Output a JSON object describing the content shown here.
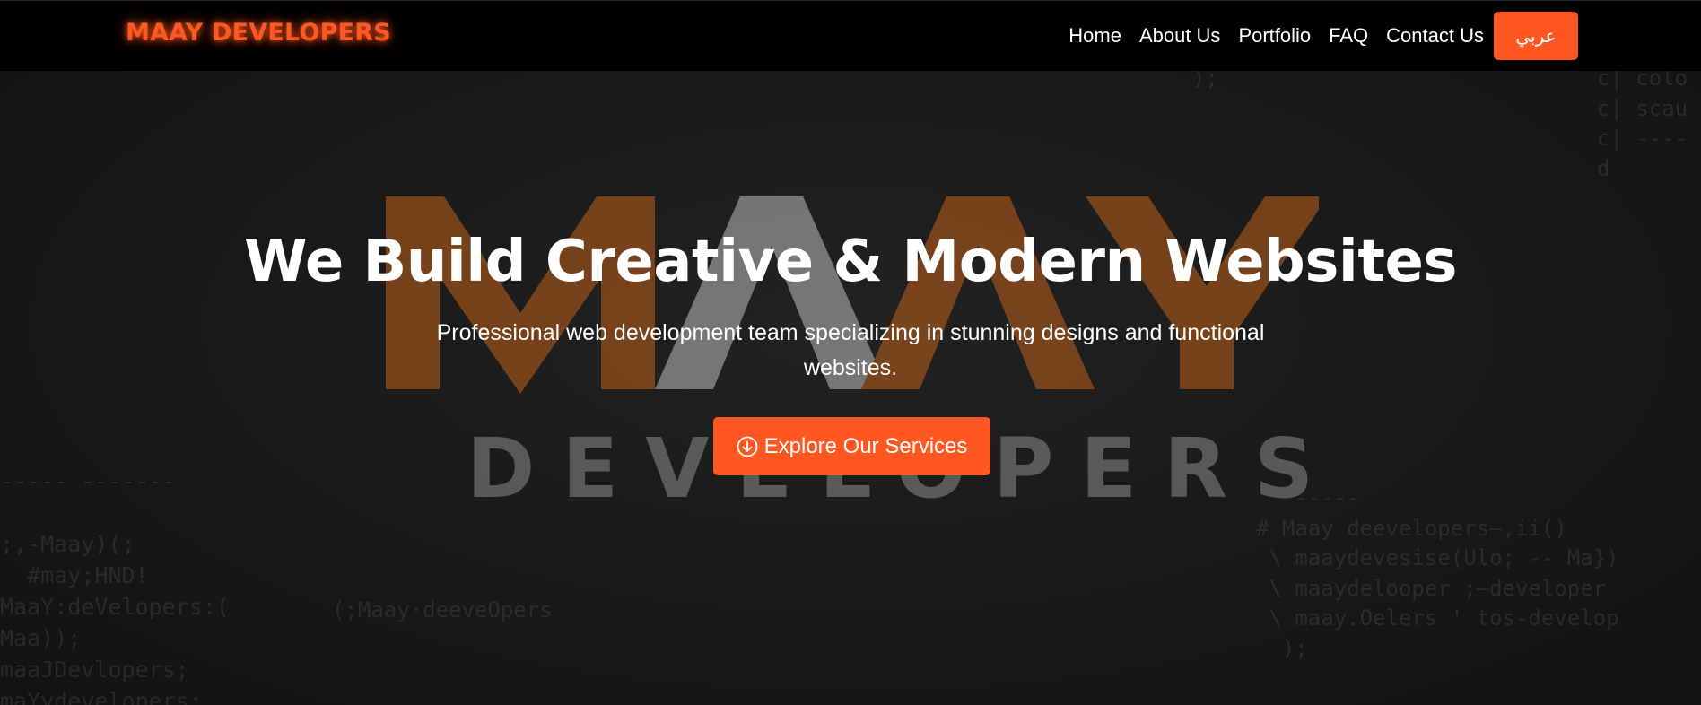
{
  "navbar": {
    "brand": "MAAY DEVELOPERS",
    "links": [
      {
        "label": "Home"
      },
      {
        "label": "About Us"
      },
      {
        "label": "Portfolio"
      },
      {
        "label": "FAQ"
      },
      {
        "label": "Contact Us"
      }
    ],
    "language_button": "عربي"
  },
  "hero": {
    "title": "We Build Creative & Modern Websites",
    "subtitle": "Professional web development team specializing in stunning designs and functional websites.",
    "cta_label": "Explore Our Services",
    "cta_icon": "arrow-down-circle-icon",
    "background_logo_top": "MAAY",
    "background_logo_bottom": "DEVELOPERS"
  },
  "colors": {
    "accent": "#ff5722",
    "navbar_bg": "#000000",
    "hero_bg": "#1a1a1a",
    "text": "#ffffff"
  }
}
